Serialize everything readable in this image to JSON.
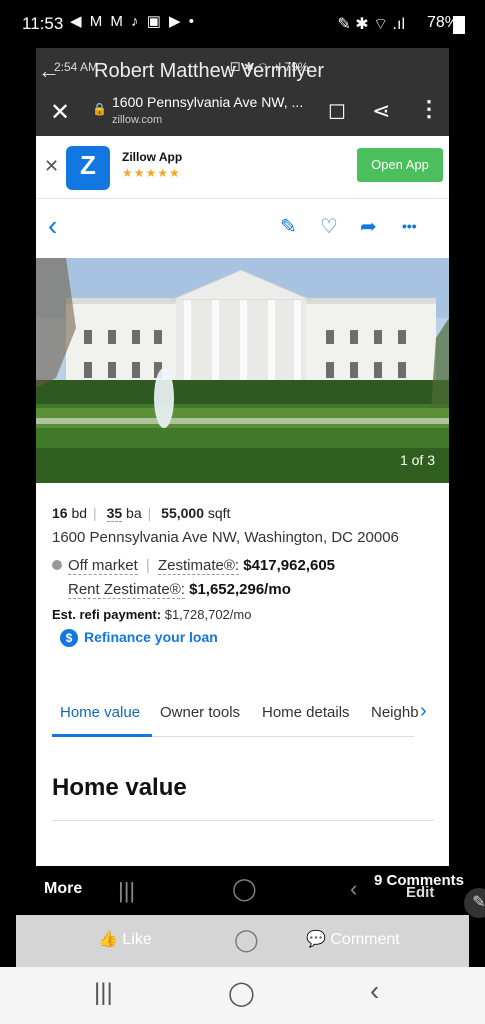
{
  "status": {
    "time": "11:53",
    "notif_icons": "◀ M M ♪ ▣ ▶ •",
    "right_icons": "✎ ✱ ⌔ .ıl",
    "battery": "78%"
  },
  "inner_status": {
    "time": "2:54 AM",
    "right": "⚀ ✱ ⌔ .ıl 79%"
  },
  "post": {
    "author": "Robert Matthew Vermilyer",
    "back_glyph": "←"
  },
  "browser": {
    "close_glyph": "✕",
    "lock_glyph": "🔒",
    "address": "1600 Pennsylvania Ave NW, ...",
    "host": "zillow.com",
    "bookmark_glyph": "☐",
    "share_glyph": "⋖",
    "menu_glyph": "⋮"
  },
  "banner": {
    "close_glyph": "✕",
    "logo_glyph": "Z",
    "app_name": "Zillow App",
    "stars": "★★★★★",
    "open_label": "Open App"
  },
  "ztool": {
    "back_glyph": "‹",
    "edit_glyph": "✎",
    "save_glyph": "♡",
    "share_glyph": "➦",
    "more_glyph": "•••"
  },
  "photo": {
    "counter": "1 of 3"
  },
  "listing": {
    "beds": "16",
    "beds_unit": "bd",
    "baths": "35",
    "baths_unit": "ba",
    "sqft": "55,000",
    "sqft_unit": "sqft",
    "address": "1600 Pennsylvania Ave NW, Washington, DC 20006",
    "market_status": "Off market",
    "zestimate_label": "Zestimate®:",
    "zestimate_value": "$417,962,605",
    "rent_label": "Rent Zestimate®:",
    "rent_value": "$1,652,296/mo",
    "refi_label": "Est. refi payment:",
    "refi_value": "$1,728,702/mo",
    "refi_link": "Refinance your loan"
  },
  "tabs": [
    {
      "label": "Home value"
    },
    {
      "label": "Owner tools"
    },
    {
      "label": "Home details"
    },
    {
      "label": "Neighb"
    }
  ],
  "section_title": "Home value",
  "facebook": {
    "more": "More",
    "comments": "9 Comments",
    "edit_glyph": "✎",
    "like": "Like",
    "comment": "Comment"
  },
  "navbar": {
    "recents": "|||",
    "home": "◯",
    "back": "‹"
  }
}
